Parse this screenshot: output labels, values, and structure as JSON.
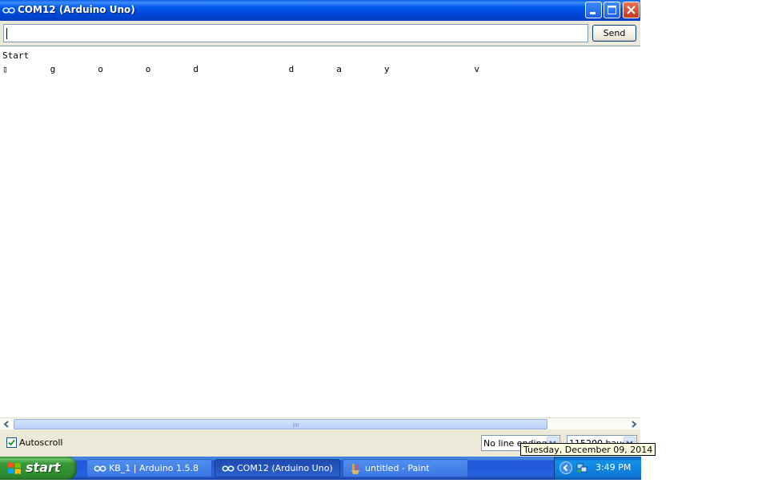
{
  "window": {
    "title": "COM12 (Arduino Uno)",
    "icon": "arduino-infinity-icon",
    "controls": [
      "minimize-icon",
      "maximize-icon",
      "close-icon"
    ]
  },
  "input": {
    "value": "",
    "send_label": "Send"
  },
  "output": {
    "lines": [
      "Start",
      "▯        g        o        o        d                 d        a        y                v"
    ]
  },
  "bottom": {
    "autoscroll_label": "Autoscroll",
    "autoscroll_checked": true,
    "line_ending": "No line ending",
    "baud": "115200 baud"
  },
  "tooltip": {
    "text": "Tuesday, December 09, 2014"
  },
  "taskbar": {
    "start_label": "start",
    "tasks": [
      {
        "label": "KB_1 | Arduino 1.5.8",
        "icon": "arduino-infinity-icon",
        "active": false
      },
      {
        "label": "COM12 (Arduino Uno)",
        "icon": "arduino-infinity-icon",
        "active": true
      },
      {
        "label": "untitled - Paint",
        "icon": "paint-icon",
        "active": false
      }
    ],
    "clock": "3:49 PM"
  },
  "colors": {
    "titlebar": "#0058ee",
    "taskbar": "#245edb",
    "start": "#3c9b3c",
    "tray": "#0f7ad8",
    "tooltip": "#ffffe1"
  }
}
